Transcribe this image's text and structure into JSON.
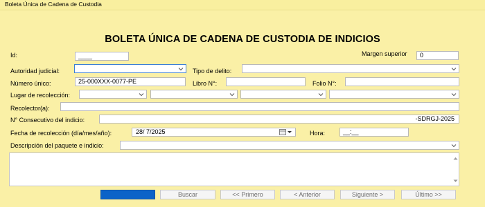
{
  "window": {
    "title": "Boleta Única de Cadena de Custodia"
  },
  "form": {
    "heading": "BOLETA ÚNICA DE CADENA DE CUSTODIA DE INDICIOS",
    "labels": {
      "id": "Id:",
      "margen_superior": "Margen superior",
      "autoridad_judicial": "Autoridad judicial:",
      "tipo_delito": "Tipo de delito:",
      "numero_unico": "Número único:",
      "libro": "Libro N°:",
      "folio": "Folio N°:",
      "lugar_recoleccion": "Lugar de recolección:",
      "recolector": "Recolector(a):",
      "consecutivo": "N° Consecutivo del indicio:",
      "fecha_recoleccion": "Fecha de recolección (día/mes/año):",
      "hora": "Hora:",
      "descripcion": "Descripción del paquete e indicio:"
    },
    "values": {
      "id": "____",
      "margen_superior": "0",
      "autoridad_judicial": "",
      "tipo_delito": "",
      "numero_unico": "25-000XXX-0077-PE",
      "libro": "",
      "folio": "",
      "recolector": "",
      "consecutivo": "-SDRGJ-2025",
      "fecha_recoleccion": "28/ 7/2025",
      "hora": "__:__"
    }
  },
  "buttons": {
    "buscar": "Buscar",
    "primero": "<< Primero",
    "anterior": "< Anterior",
    "siguiente": "Siguiente >",
    "ultimo": "Último >>"
  }
}
